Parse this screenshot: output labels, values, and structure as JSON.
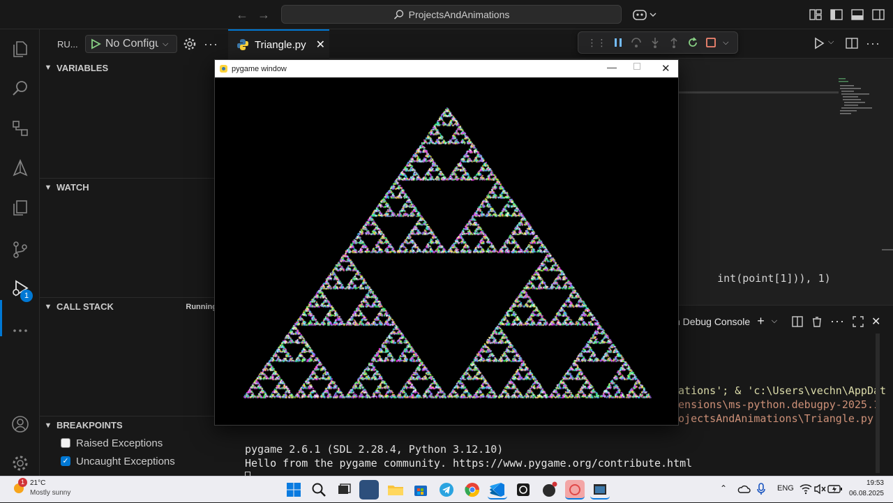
{
  "titlebar": {
    "search_text": "ProjectsAndAnimations",
    "back_icon": "arrow-left-icon",
    "forward_icon": "arrow-right-icon"
  },
  "sidebar": {
    "run_label": "RU...",
    "config_label": "No Configu",
    "sections": {
      "variables": "VARIABLES",
      "watch": "WATCH",
      "call_stack": "CALL STACK",
      "call_stack_status": "Running",
      "breakpoints": "BREAKPOINTS"
    },
    "breakpoints": [
      {
        "label": "Raised Exceptions",
        "checked": false
      },
      {
        "label": "Uncaught Exceptions",
        "checked": true
      }
    ]
  },
  "activity": {
    "debug_badge": "1"
  },
  "editor": {
    "tab_label": "Triangle.py",
    "code_fragment_a": "int(point[1])), 1)"
  },
  "panel": {
    "tab_label": "n Debug Console",
    "cmd_line_1": "nations'; & 'c:\\Users\\vechn\\AppDat",
    "cmd_line_2": "tensions\\ms-python.debugpy-2025.1",
    "cmd_line_3": "rojectsAndAnimations\\Triangle.py'",
    "out_line_1": "pygame 2.6.1 (SDL 2.28.4, Python 3.12.10)",
    "out_line_2": "Hello from the pygame community. https://www.pygame.org/contribute.html"
  },
  "pygame_window": {
    "title": "pygame window",
    "fractal_depth": 6,
    "colors": [
      "#ff3cf0",
      "#3cff6a",
      "#ffe93c",
      "#3cd8ff",
      "#ffffff",
      "#a05cff"
    ]
  },
  "taskbar": {
    "weather_temp": "21°C",
    "weather_desc": "Mostly sunny",
    "weather_badge": "1",
    "lang": "ENG",
    "time": "19:53",
    "date": "06.08.2025"
  },
  "colors": {
    "accent": "#0078d4",
    "bg": "#1f1f1f",
    "sidebar_bg": "#181818"
  }
}
